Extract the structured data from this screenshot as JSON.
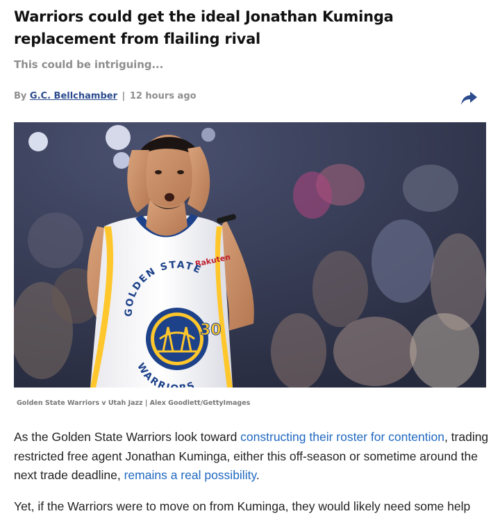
{
  "article": {
    "headline": "Warriors could get the ideal Jonathan Kuminga replacement from flailing rival",
    "subheadline": "This could be intriguing...",
    "byline": {
      "prefix": "By",
      "author": "G.C. Bellchamber",
      "separator": "|",
      "timestamp": "12 hours ago"
    },
    "share_icon": "share-arrow-icon",
    "image": {
      "caption": "Golden State Warriors v Utah Jazz | Alex Goodlett/GettyImages",
      "jersey_text": "GOLDEN STATE",
      "jersey_bottom": "WARRIORS",
      "jersey_number": "30",
      "sponsor": "Rakuten"
    },
    "paragraphs": [
      {
        "t1": "As the Golden State Warriors look toward ",
        "link1": "constructing their roster for contention",
        "t2": ", trading restricted free agent Jonathan Kuminga, either this off-season or sometime around the next trade deadline, ",
        "link2": "remains a real possibility",
        "t3": "."
      },
      {
        "t1": "Yet, if the Warriors were to move on from Kuminga, they would likely need some help"
      }
    ]
  },
  "colors": {
    "link": "#1f68c0",
    "author_link": "#2d4c8f",
    "muted": "#8e8e8e",
    "warriors_blue": "#1d428a",
    "warriors_gold": "#ffc72c"
  }
}
